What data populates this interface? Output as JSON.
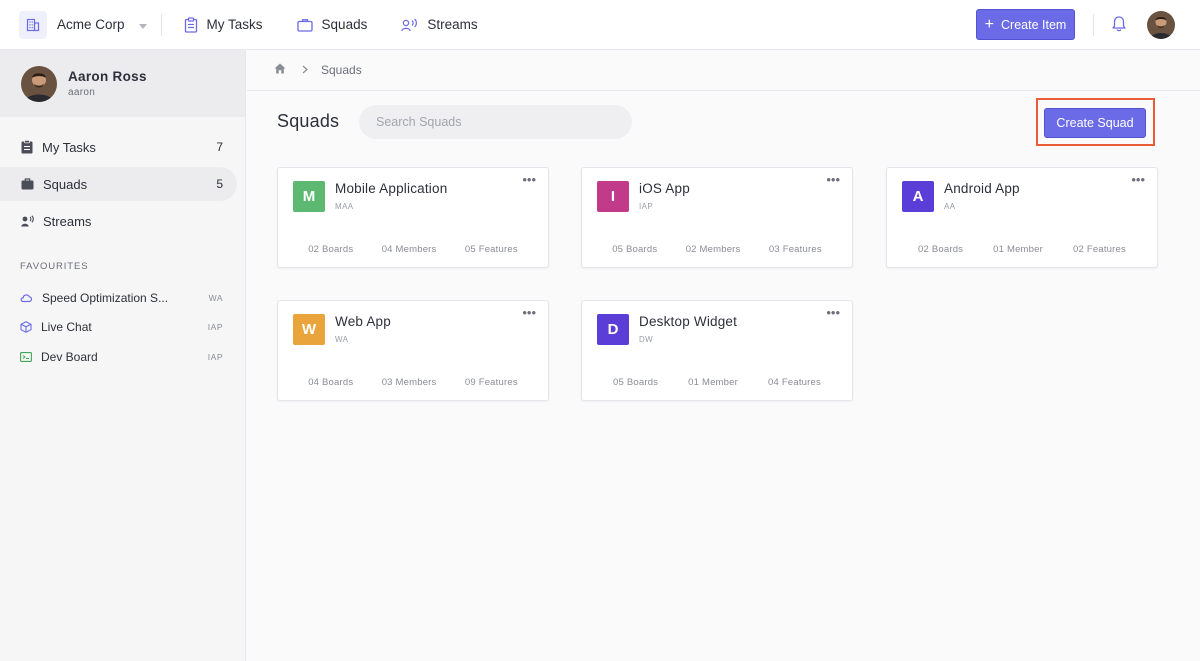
{
  "topbar": {
    "org_name": "Acme Corp",
    "nav": [
      {
        "label": "My Tasks",
        "icon": "clipboard-icon"
      },
      {
        "label": "Squads",
        "icon": "briefcase-icon"
      },
      {
        "label": "Streams",
        "icon": "streams-icon"
      }
    ],
    "create_item_label": "Create Item",
    "accent_color": "#6b6be8"
  },
  "sidebar": {
    "profile": {
      "name": "Aaron Ross",
      "username": "aaron"
    },
    "items": [
      {
        "label": "My Tasks",
        "count": "7",
        "icon": "clipboard-icon"
      },
      {
        "label": "Squads",
        "count": "5",
        "icon": "briefcase-icon",
        "active": true
      },
      {
        "label": "Streams",
        "count": "",
        "icon": "streams-icon"
      }
    ],
    "favourites_title": "FAVOURITES",
    "favourites": [
      {
        "label": "Speed Optimization S...",
        "code": "WA",
        "icon": "cloud-icon"
      },
      {
        "label": "Live Chat",
        "code": "IAP",
        "icon": "cube-icon"
      },
      {
        "label": "Dev Board",
        "code": "IAP",
        "icon": "board-icon"
      }
    ]
  },
  "breadcrumb": {
    "current": "Squads"
  },
  "main": {
    "title": "Squads",
    "search_placeholder": "Search Squads",
    "create_squad_label": "Create Squad",
    "squads": [
      {
        "letter": "M",
        "name": "Mobile Application",
        "code": "MAA",
        "color": "#5db872",
        "boards": "02 Boards",
        "members": "04 Members",
        "features": "05 Features"
      },
      {
        "letter": "I",
        "name": "iOS App",
        "code": "IAP",
        "color": "#c23a8a",
        "boards": "05 Boards",
        "members": "02 Members",
        "features": "03 Features"
      },
      {
        "letter": "A",
        "name": "Android App",
        "code": "AA",
        "color": "#5b3ed8",
        "boards": "02 Boards",
        "members": "01 Member",
        "features": "02 Features"
      },
      {
        "letter": "W",
        "name": "Web App",
        "code": "WA",
        "color": "#e9a53c",
        "boards": "04 Boards",
        "members": "03 Members",
        "features": "09 Features"
      },
      {
        "letter": "D",
        "name": "Desktop Widget",
        "code": "DW",
        "color": "#5b3ed8",
        "boards": "05 Boards",
        "members": "01 Member",
        "features": "04 Features"
      }
    ]
  }
}
